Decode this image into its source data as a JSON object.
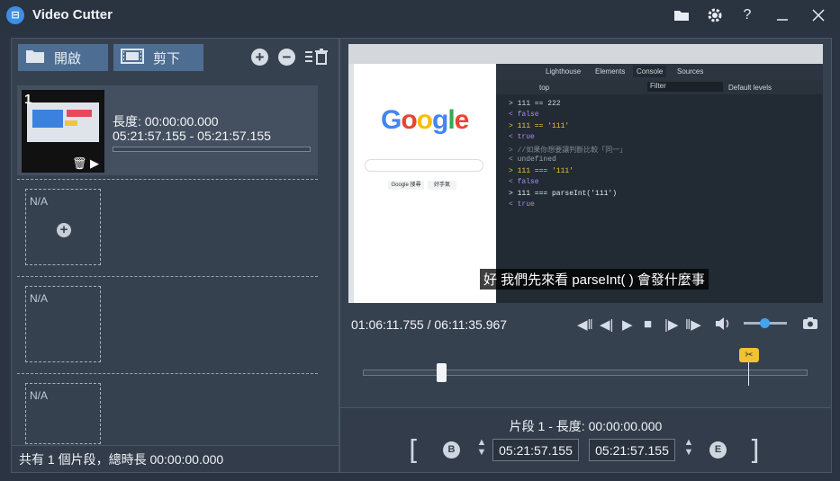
{
  "titlebar": {
    "app_icon": "film-icon",
    "title": "Video Cutter",
    "buttons": [
      "folder-icon",
      "gear-icon",
      "help-icon",
      "minimize-icon",
      "close-icon"
    ]
  },
  "left_panel": {
    "open_label": "開啟",
    "cut_label": "剪下",
    "clip": {
      "number": "1",
      "duration_line": "長度: 00:00:00.000",
      "range_line": "05:21:57.155  -  05:21:57.155"
    },
    "slot_label": "N/A",
    "footer": "共有 1 個片段，總時長 00:00:00.000"
  },
  "player": {
    "subtitle": "好 我們先來看 parseInt( ) 會發什麼事",
    "timecode": "01:06:11.755 / 06:11:35.967",
    "volume_level": 0.45,
    "timeline_position": 0.18,
    "cut_marker_position": 0.86
  },
  "segment": {
    "info": "片段 1 - 長度: 00:00:00.000",
    "start_time": "05:21:57.155",
    "end_time": "05:21:57.155",
    "begin_button": "B",
    "end_button": "E"
  },
  "devtools": {
    "tabs": [
      "Lighthouse",
      "Elements",
      "Console",
      "Sources"
    ],
    "filter_placeholder": "Filter",
    "levels": "Default levels",
    "context": "top",
    "lines": [
      "> 111 == 222",
      "< false",
      "> 111 == '111'",
      "< true",
      "> //如果你想要讓判斷比較「同一」",
      "< undefined",
      "> 111 === '111'",
      "< false",
      "> 111 === parseInt('111')",
      "< true"
    ]
  },
  "google": {
    "logo": "Google",
    "buttons": [
      "Google 搜尋",
      "好手氣"
    ]
  }
}
